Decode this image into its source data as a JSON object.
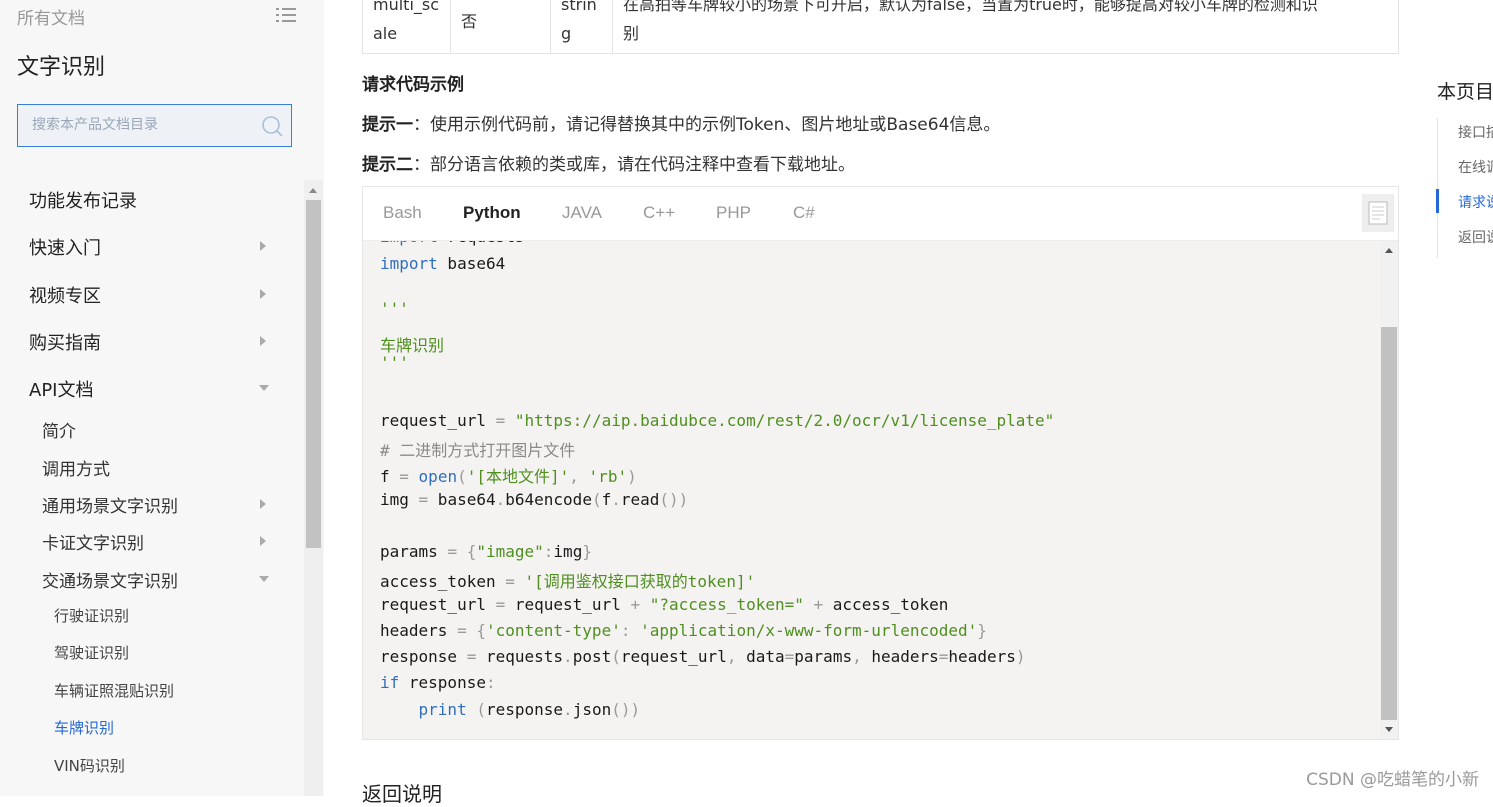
{
  "sidebar": {
    "all_docs": "所有文档",
    "product_title": "文字识别",
    "search_placeholder": "搜索本产品文档目录",
    "items": [
      {
        "label": "功能发布记录"
      },
      {
        "label": "快速入门"
      },
      {
        "label": "视频专区"
      },
      {
        "label": "购买指南"
      },
      {
        "label": "API文档"
      },
      {
        "label": "简介"
      },
      {
        "label": "调用方式"
      },
      {
        "label": "通用场景文字识别"
      },
      {
        "label": "卡证文字识别"
      },
      {
        "label": "交通场景文字识别"
      },
      {
        "label": "行驶证识别"
      },
      {
        "label": "驾驶证识别"
      },
      {
        "label": "车辆证照混贴识别"
      },
      {
        "label": "车牌识别"
      },
      {
        "label": "VIN码识别"
      }
    ]
  },
  "table_row": {
    "param": [
      "multi_sc",
      "ale"
    ],
    "required": "否",
    "type": [
      "strin",
      "g"
    ],
    "desc": [
      "在高拍等车牌较小的场景下可开启，默认为false，当置为true时，能够提高对较小车牌的检测和识",
      "别"
    ]
  },
  "section_title": "请求代码示例",
  "tip1": {
    "label": "提示一",
    "text": "：使用示例代码前，请记得替换其中的示例Token、图片地址或Base64信息。"
  },
  "tip2": {
    "label": "提示二",
    "text": "：部分语言依赖的类或库，请在代码注释中查看下载地址。"
  },
  "code_tabs": [
    "Bash",
    "Python",
    "JAVA",
    "C++",
    "PHP",
    "C#"
  ],
  "active_tab": "Python",
  "code": {
    "l0": "import requests",
    "l1": "import base64",
    "l2": "'''",
    "l3": "车牌识别",
    "l4": "'''",
    "l5": "request_url = \"https://aip.baidubce.com/rest/2.0/ocr/v1/license_plate\"",
    "l6": "# 二进制方式打开图片文件",
    "l7": "f = open('[本地文件]', 'rb')",
    "l8": "img = base64.b64encode(f.read())",
    "l9": "params = {\"image\":img}",
    "l10": "access_token = '[调用鉴权接口获取的token]'",
    "l11": "request_url = request_url + \"?access_token=\" + access_token",
    "l12": "headers = {'content-type': 'application/x-www-form-urlencoded'}",
    "l13": "response = requests.post(request_url, data=params, headers=headers)",
    "l14": "if response:",
    "l15": "    print (response.json())"
  },
  "return_title": "返回说明",
  "toc": {
    "title": "本页目录",
    "items": [
      "接口描述",
      "在线调试",
      "请求说明",
      "返回说明"
    ]
  },
  "watermark": "CSDN @吃蜡笔的小新",
  "colors": {
    "accent": "#2468d9",
    "keyword": "#2f6fbf",
    "string": "#4e8f1f",
    "code_bg": "#f4f3f1"
  }
}
